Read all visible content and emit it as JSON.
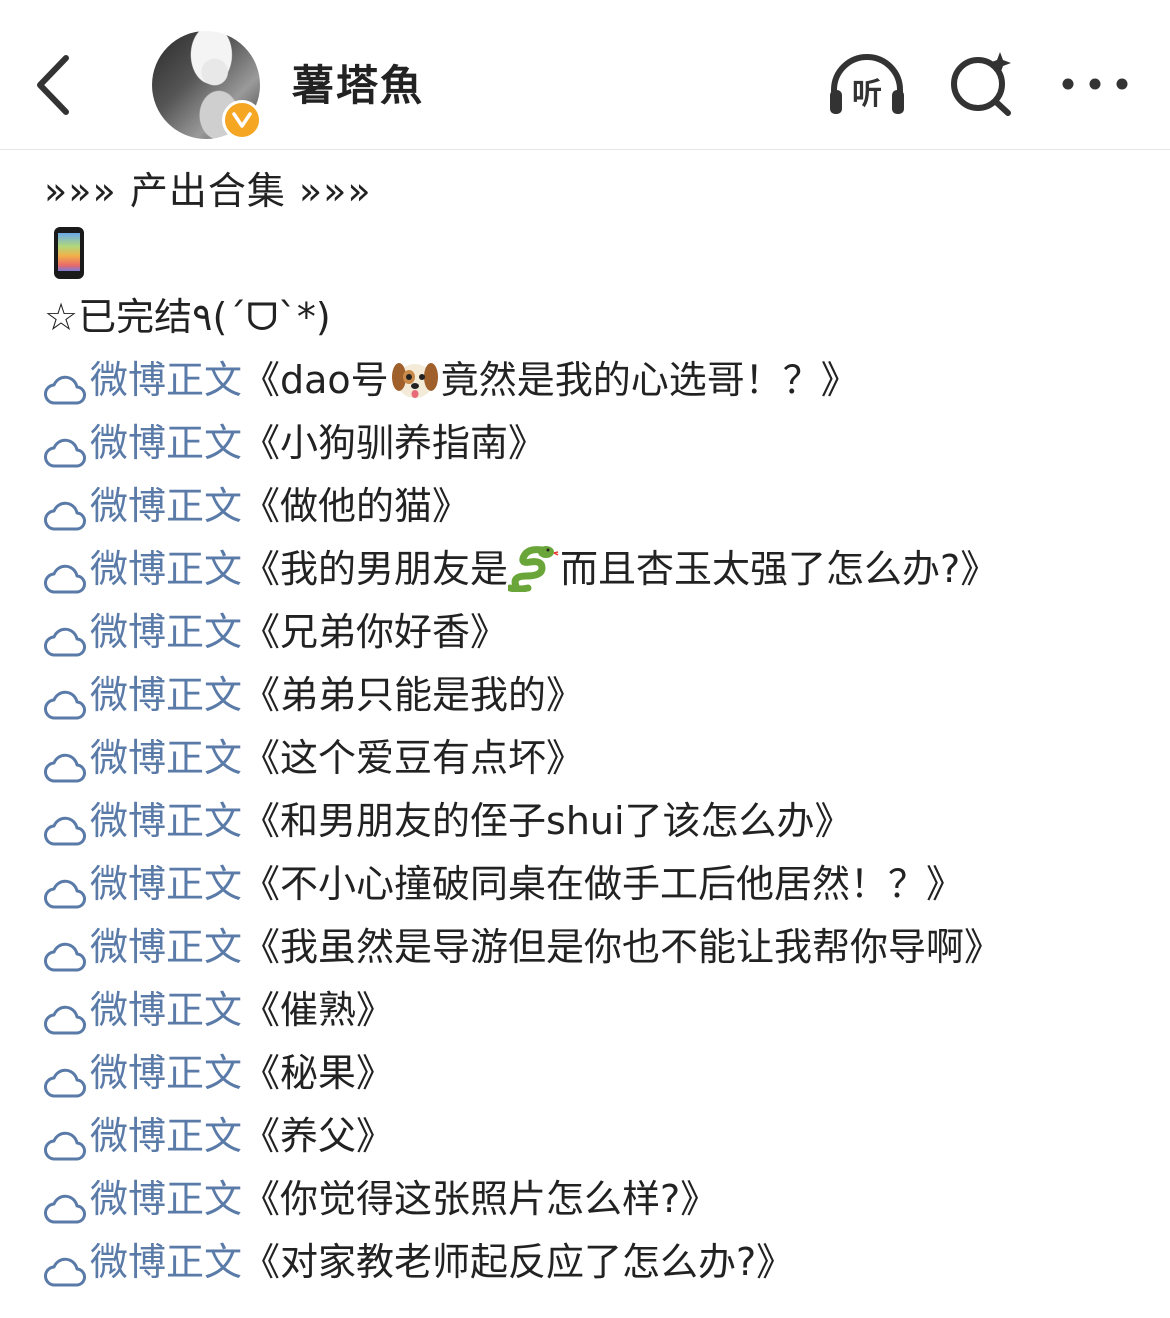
{
  "header": {
    "username": "薯塔魚",
    "listen_label": "听"
  },
  "intro": {
    "section_title": "»»» 产出合集 »»»",
    "status_line": "☆已完结٩(ˊᗜˋ*)"
  },
  "posts": [
    {
      "label": "微博正文",
      "title_pre": "《dao号",
      "emoji": "dog-emoji",
      "title_post": "竟然是我的心选哥！？》"
    },
    {
      "label": "微博正文",
      "title_pre": "《小狗驯养指南》",
      "title_post": ""
    },
    {
      "label": "微博正文",
      "title_pre": "《做他的猫》",
      "title_post": ""
    },
    {
      "label": "微博正文",
      "title_pre": "《我的男朋友是",
      "emoji": "snake-emoji",
      "title_post": "而且杏玉太强了怎么办?》"
    },
    {
      "label": "微博正文",
      "title_pre": "《兄弟你好香》",
      "title_post": ""
    },
    {
      "label": "微博正文",
      "title_pre": "《弟弟只能是我的》",
      "title_post": ""
    },
    {
      "label": "微博正文",
      "title_pre": "《这个爱豆有点坏》",
      "title_post": ""
    },
    {
      "label": "微博正文",
      "title_pre": "《和男朋友的侄子shui了该怎么办》",
      "title_post": ""
    },
    {
      "label": "微博正文",
      "title_pre": "《不小心撞破同桌在做手工后他居然！？》",
      "title_post": ""
    },
    {
      "label": "微博正文",
      "title_pre": "《我虽然是导游但是你也不能让我帮你导啊》",
      "title_post": ""
    },
    {
      "label": "微博正文",
      "title_pre": "《催熟》",
      "title_post": ""
    },
    {
      "label": "微博正文",
      "title_pre": "《秘果》",
      "title_post": ""
    },
    {
      "label": "微博正文",
      "title_pre": "《养父》",
      "title_post": ""
    },
    {
      "label": "微博正文",
      "title_pre": "《你觉得这张照片怎么样?》",
      "title_post": ""
    },
    {
      "label": "微博正文",
      "title_pre": "《对家教老师起反应了怎么办?》",
      "title_post": ""
    }
  ],
  "colors": {
    "link": "#5a7aa8",
    "text": "#222222",
    "badge": "#f5a623"
  }
}
